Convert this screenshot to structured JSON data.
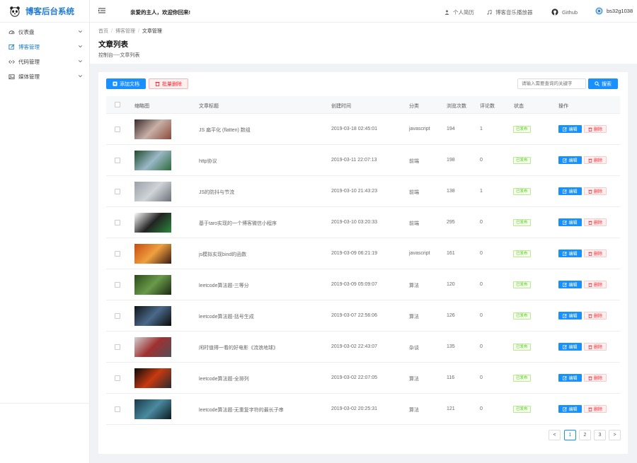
{
  "app": {
    "title": "博客后台系统"
  },
  "sidebar": {
    "items": [
      {
        "label": "仪表盘",
        "icon": "dashboard-icon"
      },
      {
        "label": "博客管理",
        "icon": "edit-icon"
      },
      {
        "label": "代码管理",
        "icon": "code-icon"
      },
      {
        "label": "媒体管理",
        "icon": "media-icon"
      }
    ]
  },
  "topbar": {
    "welcome": "亲爱的主人，欢迎你回来!",
    "resume": "个人简历",
    "music": "博客音乐播放器",
    "github": "Github",
    "user": "bs32g1038"
  },
  "breadcrumb": {
    "home": "首页",
    "section": "博客管理",
    "current": "文章管理"
  },
  "page": {
    "title": "文章列表",
    "subtitle": "控制台----文章列表"
  },
  "toolbar": {
    "add_label": "添加文档",
    "batch_delete_label": "批量删除",
    "search_placeholder": "请输入需要查询的关键字",
    "search_label": "搜索"
  },
  "table": {
    "headers": {
      "thumb": "缩略图",
      "title": "文章标题",
      "created": "创建时间",
      "category": "分类",
      "views": "浏览次数",
      "comments": "评论数",
      "status": "状态",
      "actions": "操作"
    },
    "edit_label": "编辑",
    "delete_label": "删除",
    "rows": [
      {
        "title": "JS 扁平化 (flatten) 数组",
        "created": "2019-03-18 02:45:01",
        "category": "javascript",
        "views": "194",
        "comments": "1",
        "status": "已发布",
        "thumb_colors": [
          "#3a2a2a",
          "#c8b0a8",
          "#8a4a3a"
        ]
      },
      {
        "title": "http协议",
        "created": "2019-03-11 22:07:13",
        "category": "前端",
        "views": "198",
        "comments": "0",
        "status": "已发布",
        "thumb_colors": [
          "#1f4a2a",
          "#9ab8c8",
          "#2f6a3a"
        ]
      },
      {
        "title": "JS的防抖与节流",
        "created": "2019-03-10 21:43:23",
        "category": "前端",
        "views": "138",
        "comments": "1",
        "status": "已发布",
        "thumb_colors": [
          "#9aa0a8",
          "#d0d4d8",
          "#6a707a"
        ]
      },
      {
        "title": "基于taro实现的一个博客微信小程序",
        "created": "2019-03-10 03:20:33",
        "category": "前端",
        "views": "295",
        "comments": "0",
        "status": "已发布",
        "thumb_colors": [
          "#ffffff",
          "#222222",
          "#2a8a3a"
        ]
      },
      {
        "title": "js模拟实现bind的函数",
        "created": "2019-03-09 06:21:19",
        "category": "javascript",
        "views": "161",
        "comments": "0",
        "status": "已发布",
        "thumb_colors": [
          "#c84a10",
          "#f0a040",
          "#3a1a10"
        ]
      },
      {
        "title": "leetcode算法题-三等分",
        "created": "2019-03-09 05:09:07",
        "category": "算法",
        "views": "120",
        "comments": "0",
        "status": "已发布",
        "thumb_colors": [
          "#2a4a1a",
          "#6a9a4a",
          "#1a2a10"
        ]
      },
      {
        "title": "leetcode算法题-括号生成",
        "created": "2019-03-07 22:56:06",
        "category": "算法",
        "views": "126",
        "comments": "0",
        "status": "已发布",
        "thumb_colors": [
          "#101418",
          "#4a6a8a",
          "#0a0a0a"
        ]
      },
      {
        "title": "闲时值得一看的好电影《流浪地球》",
        "created": "2019-03-02 22:43:07",
        "category": "杂谈",
        "views": "135",
        "comments": "0",
        "status": "已发布",
        "thumb_colors": [
          "#d0d0d4",
          "#a03030",
          "#505058"
        ]
      },
      {
        "title": "leetcode算法题-全排列",
        "created": "2019-03-02 22:07:05",
        "category": "算法",
        "views": "116",
        "comments": "0",
        "status": "已发布",
        "thumb_colors": [
          "#0a0a0a",
          "#c83a10",
          "#2a2a30"
        ]
      },
      {
        "title": "leetcode算法题-无重复字符的最长子串",
        "created": "2019-03-02 20:25:31",
        "category": "算法",
        "views": "121",
        "comments": "0",
        "status": "已发布",
        "thumb_colors": [
          "#1a3a4a",
          "#4a8aa0",
          "#0a1a20"
        ]
      }
    ]
  },
  "pagination": {
    "prev": "<",
    "pages": [
      "1",
      "2",
      "3"
    ],
    "next": ">",
    "current": "1"
  },
  "colors": {
    "primary": "#1890ff",
    "danger": "#f5222d",
    "success": "#52c41a",
    "brand": "#1e7ad6"
  }
}
